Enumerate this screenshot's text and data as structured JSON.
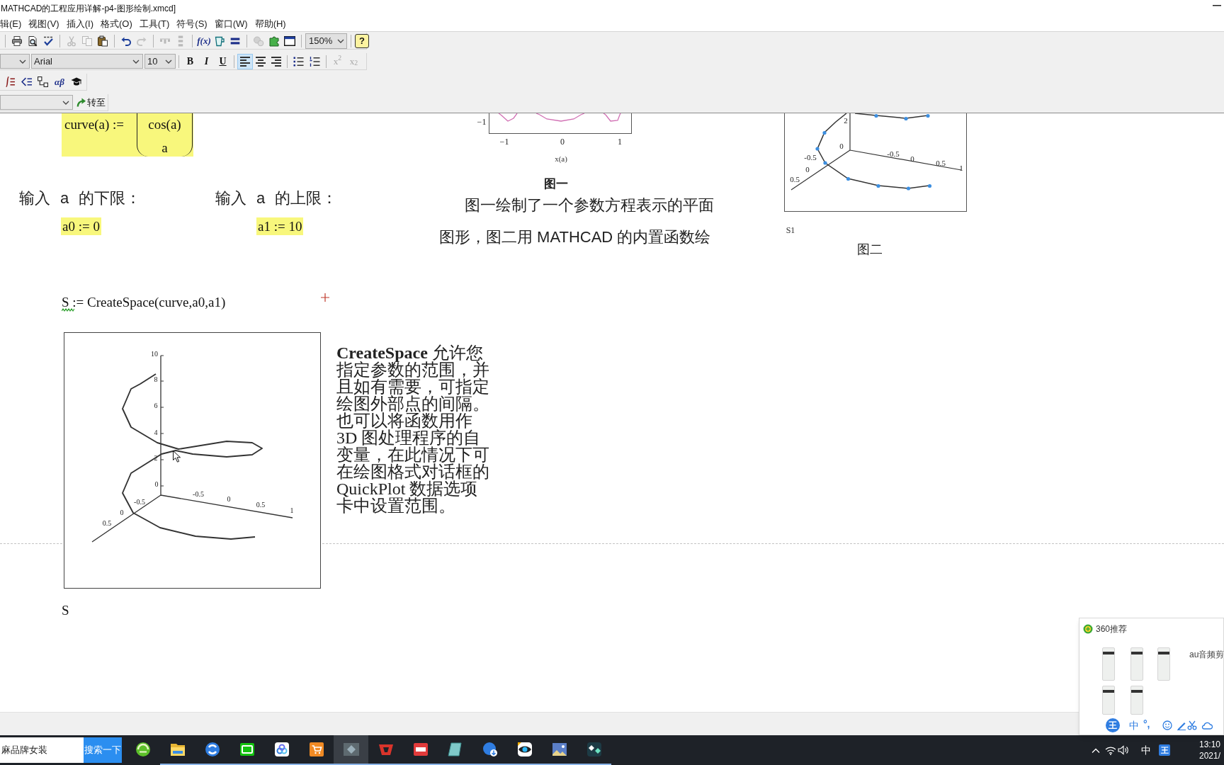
{
  "window": {
    "title": "MATHCAD的工程应用详解-p4-图形绘制.xmcd]"
  },
  "menu": [
    "辑(E)",
    "视图(V)",
    "插入(I)",
    "格式(O)",
    "工具(T)",
    "符号(S)",
    "窗口(W)",
    "帮助(H)"
  ],
  "standard_toolbar": {
    "groups": [
      [
        {
          "disabled": false
        },
        {
          "disabled": false
        },
        {
          "disabled": false
        }
      ],
      [
        {
          "disabled": true
        },
        {
          "disabled": true
        },
        {
          "disabled": false
        }
      ],
      [
        {
          "disabled": false
        },
        {
          "disabled": true
        }
      ],
      [
        {
          "disabled": true
        },
        {
          "disabled": true
        }
      ],
      [
        {
          "disabled": false,
          "label": "f(x)"
        },
        {
          "disabled": false
        },
        {
          "disabled": false
        }
      ],
      [
        {
          "disabled": true
        },
        {
          "disabled": false
        },
        {
          "disabled": false
        }
      ]
    ],
    "zoom": "150%",
    "help": "?"
  },
  "format_toolbar": {
    "font": "Arial",
    "size": "10",
    "styles": [
      {
        "label": "B"
      },
      {
        "label": "I"
      },
      {
        "label": "U"
      }
    ],
    "alignment": [
      {
        "selected": true
      },
      {
        "selected": false
      },
      {
        "selected": false
      }
    ],
    "scripts": [
      {
        "label": "x$^{2}$",
        "disabled": true
      },
      {
        "label": "x$_{2}$",
        "disabled": true
      }
    ]
  },
  "math_toolbar": {
    "greek": "αβ"
  },
  "goto_bar": {
    "button": "转至"
  },
  "document": {
    "definition": {
      "name": "curve(a) :=",
      "vector": [
        "cos(a)",
        "a"
      ]
    },
    "limits": [
      {
        "label": "输入 a 的下限：",
        "expression": "a0 := 0"
      },
      {
        "label": "输入 a 的上限：",
        "expression": "a1 := 10"
      }
    ],
    "figure_1": {
      "y_ticks": [
        "−1"
      ],
      "x_ticks": [
        "−1",
        "0",
        "1"
      ],
      "x_label": "x(a)",
      "caption": "图一"
    },
    "description": "图一绘制了一个参数方程表示的平面图形，图二用 MATHCAD 的内置函数绘",
    "figure_2": {
      "z_ticks": [
        "2",
        "0"
      ],
      "y_ticks": [
        "-0.5",
        "0",
        "0.5"
      ],
      "x_ticks": [
        "-0.5",
        "0",
        "0.5",
        "1"
      ],
      "label": "S1",
      "caption": "图二"
    },
    "assignment": {
      "text": "S := CreateSpace(curve,a0,a1)",
      "flagged": true
    },
    "plot": {
      "z_ticks": [
        "10",
        "8",
        "6",
        "4",
        "2",
        "0"
      ],
      "x_ticks": [
        "-0.5",
        "0",
        "0.5",
        "1"
      ],
      "y_ticks": [
        "-0.5",
        "0",
        "0.5"
      ]
    },
    "note": "**CreateSpace** 允许您指定参数的范围，并且如有需要，可指定绘图外部点的间隔。也可以将函数用作3D 图处理程序的自变量，在此情况下可在绘图格式对话框的QuickPlot 数据选项卡中设置范围。",
    "result": "S"
  },
  "recommendation_popup": {
    "title": "360推荐",
    "item": "au音频剪"
  },
  "ime_bar": {
    "logo": "王",
    "mode": "中",
    "punctuation": "°,"
  },
  "taskbar": {
    "search": {
      "value": "麻品牌女装"
    },
    "search_button": "搜索一下",
    "apps": [
      {
        "running": false,
        "selected": false
      },
      {
        "running": true,
        "selected": false
      },
      {
        "running": true,
        "selected": false
      },
      {
        "running": true,
        "selected": false
      },
      {
        "running": true,
        "selected": false
      },
      {
        "running": true,
        "selected": false
      },
      {
        "running": true,
        "selected": true
      },
      {
        "running": true,
        "selected": false
      },
      {
        "running": true,
        "selected": false
      },
      {
        "running": true,
        "selected": false
      },
      {
        "running": true,
        "selected": false
      },
      {
        "running": true,
        "selected": false
      },
      {
        "running": true,
        "selected": false
      },
      {
        "running": true,
        "selected": false
      }
    ],
    "tray": {
      "ime_mode": "中",
      "ime_logo": "王",
      "time": "13:10",
      "date": "2021/"
    }
  }
}
